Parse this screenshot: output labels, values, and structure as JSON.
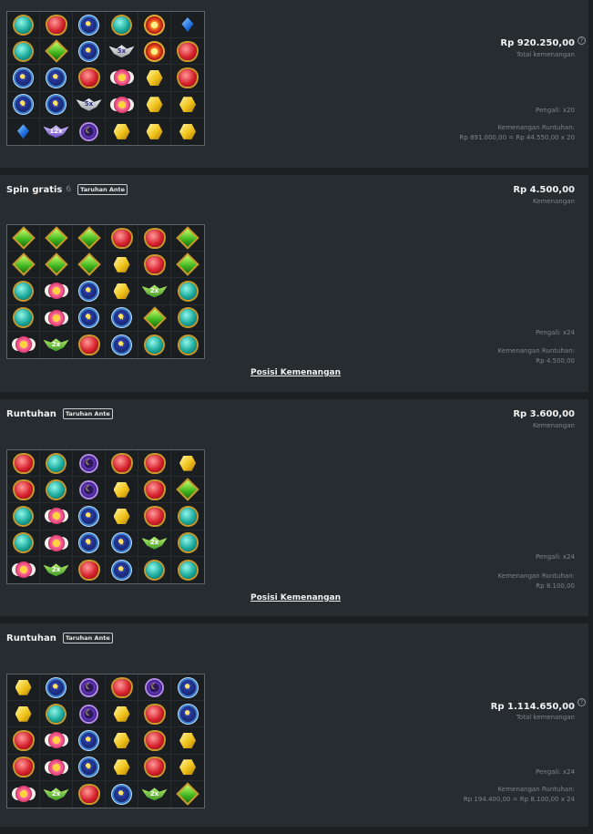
{
  "rounds": [
    {
      "title": "",
      "amount": "Rp 920.250,00",
      "amount_label": "Total kemenangan",
      "show_help": true,
      "multiplier": "Pengali: x20",
      "tumble_title": "Kemenangan Runtuhan:",
      "tumble_calc": "Rp 891.000,00 = Rp 44.550,00 x 20",
      "link": "",
      "grid": [
        [
          "teal",
          "red",
          "blue",
          "teal",
          "sun",
          "bluegem"
        ],
        [
          "teal",
          "green",
          "blue",
          "wing5",
          "sun",
          "red"
        ],
        [
          "blue",
          "blue",
          "red",
          "pink",
          "yellow",
          "red"
        ],
        [
          "blue",
          "blue",
          "wing5",
          "pink",
          "yellow",
          "yellow"
        ],
        [
          "bluegem",
          "wing12",
          "purple",
          "yellow",
          "yellow",
          "yellow"
        ]
      ]
    },
    {
      "title": "Spin gratis",
      "spin_count": "6",
      "badge": "Taruhan Ante",
      "amount": "Rp 4.500,00",
      "amount_label": "Kemenangan",
      "multiplier": "Pengali: x24",
      "tumble_title": "Kemenangan Runtuhan:",
      "tumble_calc": "Rp 4.500,00",
      "link": "Posisi Kemenangan",
      "grid": [
        [
          "green",
          "green",
          "green",
          "red",
          "red",
          "green"
        ],
        [
          "green",
          "green",
          "green",
          "yellow",
          "red",
          "green"
        ],
        [
          "teal",
          "pink",
          "blue",
          "yellow",
          "wing2",
          "teal"
        ],
        [
          "teal",
          "pink",
          "blue",
          "blue",
          "green",
          "teal"
        ],
        [
          "pink",
          "wing2",
          "red",
          "blue",
          "teal",
          "teal"
        ]
      ]
    },
    {
      "title": "Runtuhan",
      "badge": "Taruhan Ante",
      "amount": "Rp 3.600,00",
      "amount_label": "Kemenangan",
      "multiplier": "Pengali: x24",
      "tumble_title": "Kemenangan Runtuhan:",
      "tumble_calc": "Rp 8.100,00",
      "link": "Posisi Kemenangan",
      "grid": [
        [
          "red",
          "teal",
          "purple",
          "red",
          "red",
          "yellow"
        ],
        [
          "red",
          "teal",
          "purple",
          "yellow",
          "red",
          "green"
        ],
        [
          "teal",
          "pink",
          "blue",
          "yellow",
          "red",
          "teal"
        ],
        [
          "teal",
          "pink",
          "blue",
          "blue",
          "wing2",
          "teal"
        ],
        [
          "pink",
          "wing2",
          "red",
          "blue",
          "teal",
          "teal"
        ]
      ]
    },
    {
      "title": "Runtuhan",
      "badge": "Taruhan Ante",
      "amount": "Rp 1.114.650,00",
      "amount_label": "Total kemenangan",
      "show_help": true,
      "multiplier": "Pengali: x24",
      "tumble_title": "Kemenangan Runtuhan:",
      "tumble_calc": "Rp 194.400,00 = Rp 8.100,00 x 24",
      "link": "",
      "grid": [
        [
          "yellow",
          "blue",
          "purple",
          "red",
          "purple",
          "blue"
        ],
        [
          "yellow",
          "teal",
          "purple",
          "yellow",
          "red",
          "blue"
        ],
        [
          "red",
          "pink",
          "blue",
          "yellow",
          "red",
          "yellow"
        ],
        [
          "red",
          "pink",
          "blue",
          "yellow",
          "red",
          "yellow"
        ],
        [
          "pink",
          "wing2",
          "red",
          "blue",
          "wing2",
          "green"
        ]
      ]
    }
  ]
}
